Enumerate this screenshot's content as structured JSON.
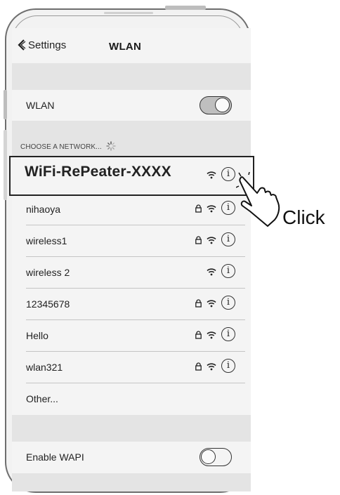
{
  "nav": {
    "back_label": "Settings",
    "title": "WLAN"
  },
  "wlan_row": {
    "label": "WLAN",
    "toggle_on": true
  },
  "networks_header": "CHOOSE A NETWORK...",
  "networks": [
    {
      "name": "WiFi-RePeater-XXXX",
      "locked": false,
      "highlighted": true
    },
    {
      "name": "nihaoya",
      "locked": true
    },
    {
      "name": "wireless1",
      "locked": true
    },
    {
      "name": "wireless 2",
      "locked": false
    },
    {
      "name": "12345678",
      "locked": true
    },
    {
      "name": "Hello",
      "locked": true
    },
    {
      "name": "wlan321",
      "locked": true
    }
  ],
  "other_label": "Other...",
  "wapi_row": {
    "label": "Enable WAPI",
    "toggle_on": false
  },
  "callout": {
    "label": "Click"
  },
  "icons": {
    "back": "chevron-left-icon",
    "lock": "lock-icon",
    "wifi": "wifi-icon",
    "info": "info-icon",
    "spinner": "loading-spinner-icon",
    "hand": "pointing-hand-icon"
  },
  "colors": {
    "screen_bg": "#f4f4f4",
    "band_bg": "#e4e4e4",
    "outline": "#222222"
  }
}
